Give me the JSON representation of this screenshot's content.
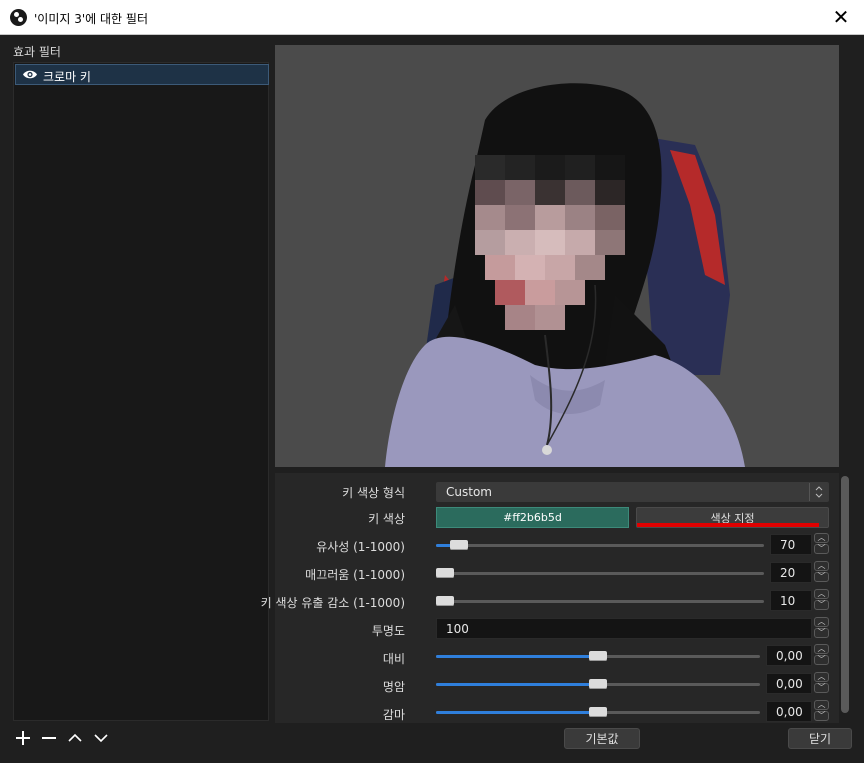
{
  "window": {
    "title": "'이미지 3'에 대한 필터",
    "close_glyph": "✕"
  },
  "left_panel": {
    "label": "효과 필터",
    "items": [
      {
        "label": "크로마 키",
        "selected": true,
        "visible": true
      }
    ],
    "tools": [
      {
        "name": "add",
        "glyph": "+"
      },
      {
        "name": "remove",
        "glyph": "−"
      },
      {
        "name": "move-up",
        "glyph": "︿"
      },
      {
        "name": "move-down",
        "glyph": "﹀"
      }
    ]
  },
  "properties": {
    "key_color_type": {
      "label": "키 색상 형식",
      "value": "Custom"
    },
    "key_color": {
      "label": "키 색상",
      "value": "#ff2b6b5d",
      "swatch": "#2b6b5d",
      "button": "색상 지정"
    },
    "similarity": {
      "label": "유사성 (1-1000)",
      "value": "70",
      "fraction": 0.07
    },
    "smoothness": {
      "label": "매끄러움 (1-1000)",
      "value": "20",
      "fraction": 0.02
    },
    "spill": {
      "label": "키 색상 유출 감소 (1-1000)",
      "value": "10",
      "fraction": 0.01
    },
    "opacity": {
      "label": "투명도",
      "value": "100"
    },
    "contrast": {
      "label": "대비",
      "value": "0,00",
      "fraction": 0.5
    },
    "brightness": {
      "label": "명암",
      "value": "0,00",
      "fraction": 0.5
    },
    "gamma": {
      "label": "감마",
      "value": "0,00",
      "fraction": 0.5
    }
  },
  "buttons": {
    "defaults": "기본값",
    "close": "닫기"
  },
  "colors": {
    "accent": "#2f7fdc",
    "selection": "#1e3246",
    "highlight": "#e00000"
  }
}
